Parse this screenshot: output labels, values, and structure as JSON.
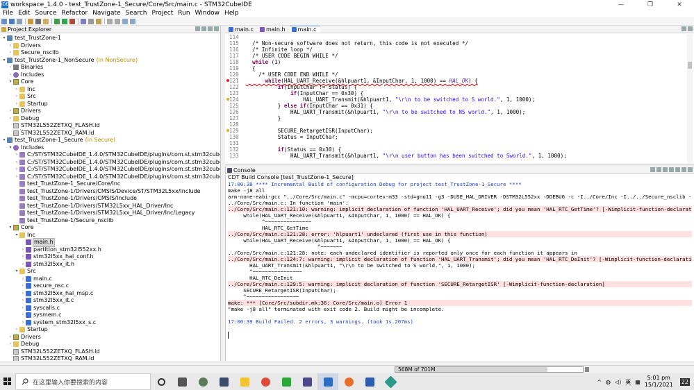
{
  "window": {
    "title": "workspace_1.4.0 - test_TrustZone-1_Secure/Core/Src/main.c - STM32CubeIDE",
    "app_icon": "IDE",
    "controls": [
      "—",
      "❐",
      "✕"
    ]
  },
  "menu": [
    "File",
    "Edit",
    "Source",
    "Refactor",
    "Navigate",
    "Search",
    "Project",
    "Run",
    "Window",
    "Help"
  ],
  "explorer": {
    "title": "Project Explorer",
    "items": [
      {
        "label": "test_TrustZone-1",
        "dec": "",
        "indent": 1,
        "arrow": "▾",
        "icon": "project"
      },
      {
        "label": "Drivers",
        "dec": "",
        "indent": 2,
        "arrow": "›",
        "icon": "folder"
      },
      {
        "label": "Secure_nsclib",
        "dec": "",
        "indent": 2,
        "arrow": "›",
        "icon": "folder"
      },
      {
        "label": "test_TrustZone-1_NonSecure",
        "dec": "(in NonSecure)",
        "indent": 1,
        "arrow": "▾",
        "icon": "project"
      },
      {
        "label": "Binaries",
        "dec": "",
        "indent": 2,
        "arrow": "›",
        "icon": "binaries"
      },
      {
        "label": "Includes",
        "dec": "",
        "indent": 2,
        "arrow": "›",
        "icon": "includes"
      },
      {
        "label": "Core",
        "dec": "",
        "indent": 2,
        "arrow": "▾",
        "icon": "srcfolder"
      },
      {
        "label": "Inc",
        "dec": "",
        "indent": 3,
        "arrow": "›",
        "icon": "folder"
      },
      {
        "label": "Src",
        "dec": "",
        "indent": 3,
        "arrow": "›",
        "icon": "folder"
      },
      {
        "label": "Startup",
        "dec": "",
        "indent": 3,
        "arrow": "›",
        "icon": "folder"
      },
      {
        "label": "Drivers",
        "dec": "",
        "indent": 2,
        "arrow": "›",
        "icon": "srcfolder"
      },
      {
        "label": "Debug",
        "dec": "",
        "indent": 2,
        "arrow": "›",
        "icon": "folder"
      },
      {
        "label": "STM32L552ZETXQ_FLASH.ld",
        "dec": "",
        "indent": 2,
        "arrow": "",
        "icon": "ldfile"
      },
      {
        "label": "STM32L552ZETXQ_RAM.ld",
        "dec": "",
        "indent": 2,
        "arrow": "",
        "icon": "ldfile"
      },
      {
        "label": "test_TrustZone-1_Secure",
        "dec": "(in Secure)",
        "indent": 1,
        "arrow": "▾",
        "icon": "project"
      },
      {
        "label": "Includes",
        "dec": "",
        "indent": 2,
        "arrow": "▾",
        "icon": "includes"
      },
      {
        "label": "C:/ST/STM32CubeIDE_1.4.0/STM32CubeIDE/plugins/com.st.stm32cube.ide.mcu",
        "dec": "",
        "indent": 3,
        "arrow": "›",
        "icon": "incpath"
      },
      {
        "label": "C:/ST/STM32CubeIDE_1.4.0/STM32CubeIDE/plugins/com.st.stm32cube.ide.mcu",
        "dec": "",
        "indent": 3,
        "arrow": "›",
        "icon": "incpath"
      },
      {
        "label": "C:/ST/STM32CubeIDE_1.4.0/STM32CubeIDE/plugins/com.st.stm32cube.ide.mcu",
        "dec": "",
        "indent": 3,
        "arrow": "›",
        "icon": "incpath"
      },
      {
        "label": "C:/ST/STM32CubeIDE_1.4.0/STM32CubeIDE/plugins/com.st.stm32cube.ide.mcu",
        "dec": "",
        "indent": 3,
        "arrow": "›",
        "icon": "incpath"
      },
      {
        "label": "test_TrustZone-1_Secure/Core/Inc",
        "dec": "",
        "indent": 3,
        "arrow": "",
        "icon": "incpath"
      },
      {
        "label": "test_TrustZone-1/Drivers/CMSIS/Device/ST/STM32L5xx/Include",
        "dec": "",
        "indent": 3,
        "arrow": "",
        "icon": "incpath"
      },
      {
        "label": "test_TrustZone-1/Drivers/CMSIS/Include",
        "dec": "",
        "indent": 3,
        "arrow": "",
        "icon": "incpath"
      },
      {
        "label": "test_TrustZone-1/Drivers/STM32L5xx_HAL_Driver/Inc",
        "dec": "",
        "indent": 3,
        "arrow": "",
        "icon": "incpath"
      },
      {
        "label": "test_TrustZone-1/Drivers/STM32L5xx_HAL_Driver/Inc/Legacy",
        "dec": "",
        "indent": 3,
        "arrow": "",
        "icon": "incpath"
      },
      {
        "label": "test_TrustZone-1/Secure_nsclib",
        "dec": "",
        "indent": 3,
        "arrow": "",
        "icon": "incpath"
      },
      {
        "label": "Core",
        "dec": "",
        "indent": 2,
        "arrow": "▾",
        "icon": "srcfolder"
      },
      {
        "label": "Inc",
        "dec": "",
        "indent": 3,
        "arrow": "▾",
        "icon": "folder"
      },
      {
        "label": "main.h",
        "dec": "",
        "indent": 4,
        "arrow": "",
        "icon": "hfile",
        "selected": true
      },
      {
        "label": "partition_stm32l552xx.h",
        "dec": "",
        "indent": 4,
        "arrow": "›",
        "icon": "hfile"
      },
      {
        "label": "stm32l5xx_hal_conf.h",
        "dec": "",
        "indent": 4,
        "arrow": "›",
        "icon": "hfile"
      },
      {
        "label": "stm32l5xx_it.h",
        "dec": "",
        "indent": 4,
        "arrow": "›",
        "icon": "hfile"
      },
      {
        "label": "Src",
        "dec": "",
        "indent": 3,
        "arrow": "▾",
        "icon": "folder"
      },
      {
        "label": "main.c",
        "dec": "",
        "indent": 4,
        "arrow": "›",
        "icon": "cfile"
      },
      {
        "label": "secure_nsc.c",
        "dec": "",
        "indent": 4,
        "arrow": "›",
        "icon": "cfile"
      },
      {
        "label": "stm32l5xx_hal_msp.c",
        "dec": "",
        "indent": 4,
        "arrow": "›",
        "icon": "cfile"
      },
      {
        "label": "stm32l5xx_it.c",
        "dec": "",
        "indent": 4,
        "arrow": "›",
        "icon": "cfile"
      },
      {
        "label": "syscalls.c",
        "dec": "",
        "indent": 4,
        "arrow": "›",
        "icon": "cfile"
      },
      {
        "label": "sysmem.c",
        "dec": "",
        "indent": 4,
        "arrow": "›",
        "icon": "cfile"
      },
      {
        "label": "system_stm32l5xx_s.c",
        "dec": "",
        "indent": 4,
        "arrow": "›",
        "icon": "cfile"
      },
      {
        "label": "Startup",
        "dec": "",
        "indent": 3,
        "arrow": "›",
        "icon": "folder"
      },
      {
        "label": "Drivers",
        "dec": "",
        "indent": 2,
        "arrow": "›",
        "icon": "srcfolder"
      },
      {
        "label": "Debug",
        "dec": "",
        "indent": 2,
        "arrow": "›",
        "icon": "folder"
      },
      {
        "label": "STM32L552ZETXQ_FLASH.ld",
        "dec": "",
        "indent": 2,
        "arrow": "",
        "icon": "ldfile"
      },
      {
        "label": "STM32L552ZETXQ_RAM.ld",
        "dec": "",
        "indent": 2,
        "arrow": "",
        "icon": "ldfile"
      }
    ]
  },
  "editor": {
    "tabs": [
      {
        "label": "main.c",
        "active": false
      },
      {
        "label": "main.h",
        "active": false
      },
      {
        "label": "main.c",
        "active": true
      }
    ],
    "lines": [
      {
        "n": "114",
        "t": "",
        "k": "plain"
      },
      {
        "n": "115",
        "t": "  /* Non-secure software does not return, this code is not executed */",
        "k": "cm"
      },
      {
        "n": "116",
        "t": "  /* Infinite loop */",
        "k": "cm"
      },
      {
        "n": "117",
        "t": "  /* USER CODE BEGIN WHILE */",
        "k": "cm"
      },
      {
        "n": "118",
        "t": "  while (1)",
        "k": "kwline"
      },
      {
        "n": "119",
        "t": "  {",
        "k": "plain"
      },
      {
        "n": "120",
        "t": "    /* USER CODE END WHILE */",
        "k": "cm"
      },
      {
        "n": "121",
        "t": "      while(HAL_UART_Receive(&hlpuart1, &InputChar, 1, 1000) == HAL_OK) {",
        "k": "err",
        "marker": "#e02020"
      },
      {
        "n": "122",
        "t": "          if(InputChar != Status) {",
        "k": "plain"
      },
      {
        "n": "123",
        "t": "              if(InputChar == 0x30) {",
        "k": "plain"
      },
      {
        "n": "124",
        "t": "                  HAL_UART_Transmit(&hlpuart1, \"\\r\\n to be switched to S world.\", 1, 1000);",
        "k": "str",
        "marker": "#e0b020"
      },
      {
        "n": "125",
        "t": "          } else if(InputChar == 0x31) {",
        "k": "plain"
      },
      {
        "n": "126",
        "t": "              HAL_UART_Transmit(&hlpuart1, \"\\r\\n to be switched to NS world.\", 1, 1000);",
        "k": "str"
      },
      {
        "n": "127",
        "t": "          }",
        "k": "plain"
      },
      {
        "n": "128",
        "t": "",
        "k": "plain"
      },
      {
        "n": "129",
        "t": "          SECURE_RetargetISR(InputChar);",
        "k": "plain",
        "marker": "#e0b020"
      },
      {
        "n": "130",
        "t": "          Status = InputChar;",
        "k": "plain"
      },
      {
        "n": "131",
        "t": "",
        "k": "plain"
      },
      {
        "n": "132",
        "t": "          if(Status == 0x30) {",
        "k": "plain"
      },
      {
        "n": "133",
        "t": "              HAL_UART_Transmit(&hlpuart1, \"\\r\\n user button has been switched to Sworld.\", 1, 1000);",
        "k": "str"
      }
    ]
  },
  "console": {
    "tab_label": "Console",
    "subtitle": "CDT Build Console [test_TrustZone-1_Secure]",
    "lines": [
      {
        "t": "17:00:38 **** Incremental Build of configuration Debug for project test_TrustZone-1_Secure ****",
        "k": "info"
      },
      {
        "t": "make -j8 all",
        "k": "norm"
      },
      {
        "t": "arm-none-eabi-gcc \"../Core/Src/main.c\" -mcpu=cortex-m33 -std=gnu11 -g3 -DUSE_HAL_DRIVER -DSTM32L552xx -DDEBUG -c -I../Core/Inc -I../../Secure_nsclib -I../",
        "k": "norm"
      },
      {
        "t": "../Core/Src/main.c: In function 'main':",
        "k": "norm"
      },
      {
        "t": "../Core/Src/main.c:121:10: warning: implicit declaration of function 'HAL_UART_Receive'; did you mean 'HAL_RTC_GetTime'? [-Wimplicit-function-declaration]",
        "k": "errbg"
      },
      {
        "t": "     while(HAL_UART_Receive(&hlpuart1, &InputChar, 1, 1000) == HAL_OK) {",
        "k": "norm"
      },
      {
        "t": "           ^~~~~~~~~~~~~~~~",
        "k": "norm"
      },
      {
        "t": "           HAL_RTC_GetTime",
        "k": "norm"
      },
      {
        "t": "../Core/Src/main.c:121:28: error: 'hlpuart1' undeclared (first use in this function)",
        "k": "errbg"
      },
      {
        "t": "     while(HAL_UART_Receive(&hlpuart1, &InputChar, 1, 1000) == HAL_OK) {",
        "k": "norm"
      },
      {
        "t": "                             ^~~~~~~~",
        "k": "norm"
      },
      {
        "t": "../Core/Src/main.c:121:28: note: each undeclared identifier is reported only once for each function it appears in",
        "k": "norm"
      },
      {
        "t": "../Core/Src/main.c:124:7: warning: implicit declaration of function 'HAL_UART_Transmit'; did you mean 'HAL_RTC_DeInit'? [-Wimplicit-function-declaration]",
        "k": "errbg"
      },
      {
        "t": "       HAL_UART_Transmit(&hlpuart1, \"\\r\\n to be switched to S world.\", 1, 1000);",
        "k": "norm"
      },
      {
        "t": "       ^~~~~~~~~~~~~~~~~",
        "k": "norm"
      },
      {
        "t": "       HAL_RTC_DeInit",
        "k": "norm"
      },
      {
        "t": "../Core/Src/main.c:129:5: warning: implicit declaration of function 'SECURE_RetargetISR' [-Wimplicit-function-declaration]",
        "k": "errbg"
      },
      {
        "t": "     SECURE_RetargetISR(InputChar);",
        "k": "norm"
      },
      {
        "t": "     ^~~~~~~~~~~~~~~~~~",
        "k": "norm"
      },
      {
        "t": "make: *** [Core/Src/subdir.mk:36: Core/Src/main.o] Error 1",
        "k": "errbg"
      },
      {
        "t": "\"make -j8 all\" terminated with exit code 2. Build might be incomplete.",
        "k": "norm"
      },
      {
        "t": "",
        "k": "norm"
      },
      {
        "t": "17:00:39 Build Failed. 2 errors, 3 warnings. (took 1s.207ms)",
        "k": "info"
      }
    ]
  },
  "status": {
    "memory": "568M of 701M",
    "memory_fraction": 0.81
  },
  "taskbar": {
    "search_placeholder": "在这里输入你要搜索的内容",
    "time": "5:01 pm",
    "date": "15/1/2021",
    "ime": "英",
    "notif": "22"
  },
  "colors": {
    "info": "#1f3fbf",
    "error_bg": "#ffe0e0",
    "decoration": "#b58900",
    "keyword": "#7f0055",
    "comment": "#3f5fbf",
    "string": "#2a00ff"
  }
}
